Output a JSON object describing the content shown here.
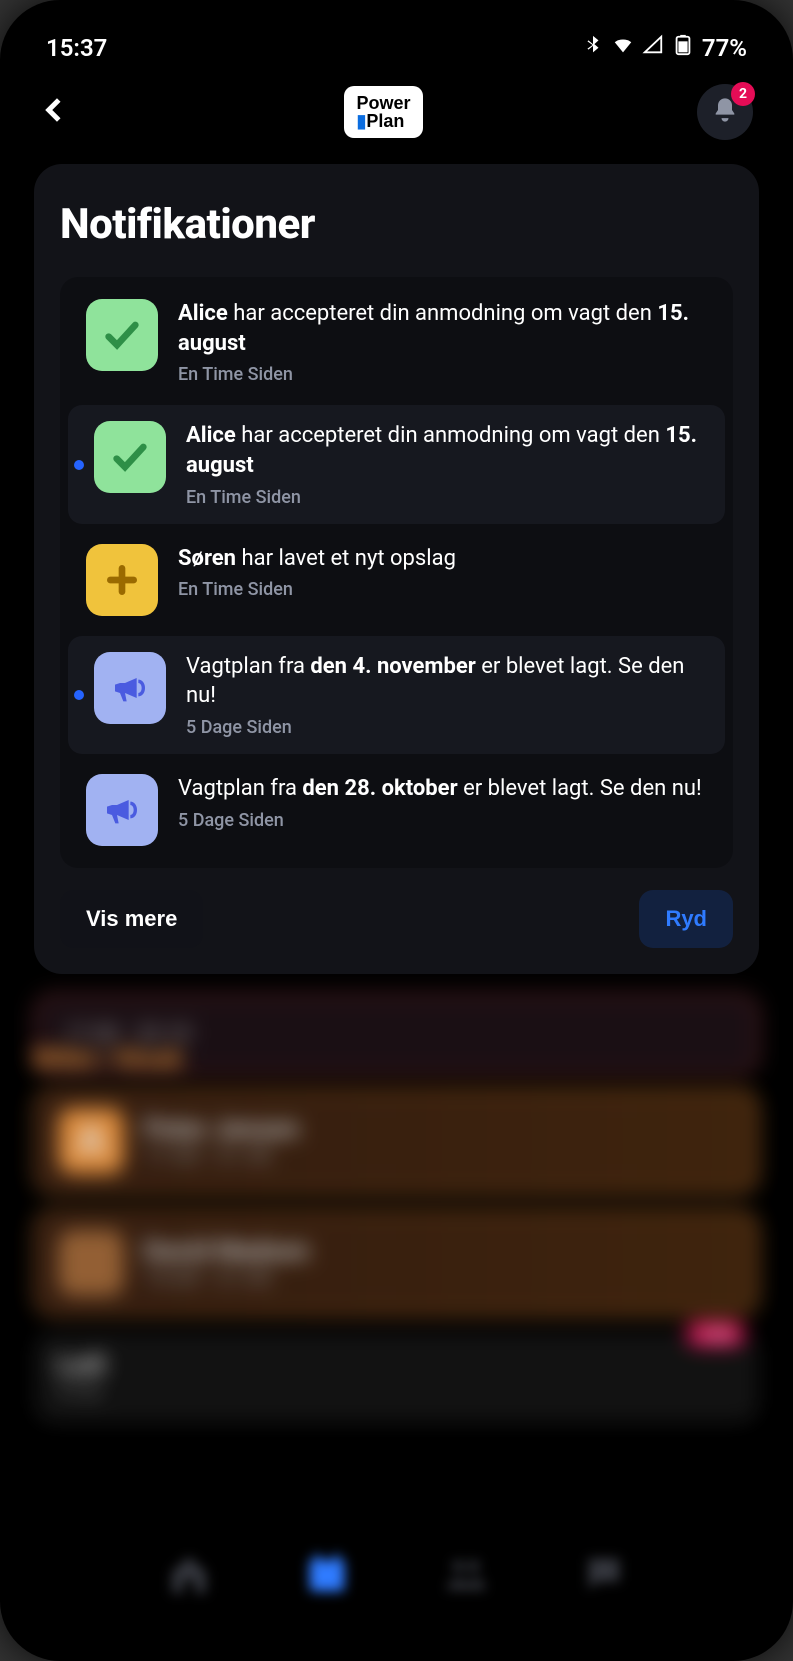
{
  "status": {
    "time": "15:37",
    "battery": "77%"
  },
  "header": {
    "logo_top": "Power",
    "logo_bottom": "Plan",
    "badge": "2"
  },
  "panel": {
    "title": "Notifikationer",
    "show_more": "Vis mere",
    "clear": "Ryd"
  },
  "notifications": [
    {
      "unread": false,
      "icon": "check",
      "time": "En Time Siden",
      "b1": "Alice",
      "t1": " har accepteret din anmodning om vagt den ",
      "b2": "15. august",
      "t2": ""
    },
    {
      "unread": true,
      "icon": "check",
      "time": "En Time Siden",
      "b1": "Alice",
      "t1": " har accepteret din anmodning om vagt den ",
      "b2": "15. august",
      "t2": ""
    },
    {
      "unread": false,
      "icon": "plus",
      "time": "En Time Siden",
      "b1": "Søren",
      "t1": " har lavet et nyt opslag",
      "b2": "",
      "t2": ""
    },
    {
      "unread": true,
      "icon": "megaphone",
      "time": "5 Dage Siden",
      "b1": "",
      "t1": "Vagtplan fra ",
      "b2": "den 4. november",
      "t2": " er blevet lagt. Se den nu!"
    },
    {
      "unread": false,
      "icon": "megaphone",
      "time": "5 Dage Siden",
      "b1": "",
      "t1": "Vagtplan fra ",
      "b2": "den 28. oktober",
      "t2": " er blevet lagt. Se den nu!"
    }
  ],
  "bg": {
    "section": "Billet / Kiosk",
    "shifts": [
      {
        "name": "Peter Jensen",
        "time": "17.00 - 21.30"
      },
      {
        "name": "David Madsen",
        "time": "15.00 - 21.00"
      }
    ],
    "ledig_name": "Ledi",
    "ledig_time": "17.0",
    "ledig_pill": "Ledig"
  }
}
